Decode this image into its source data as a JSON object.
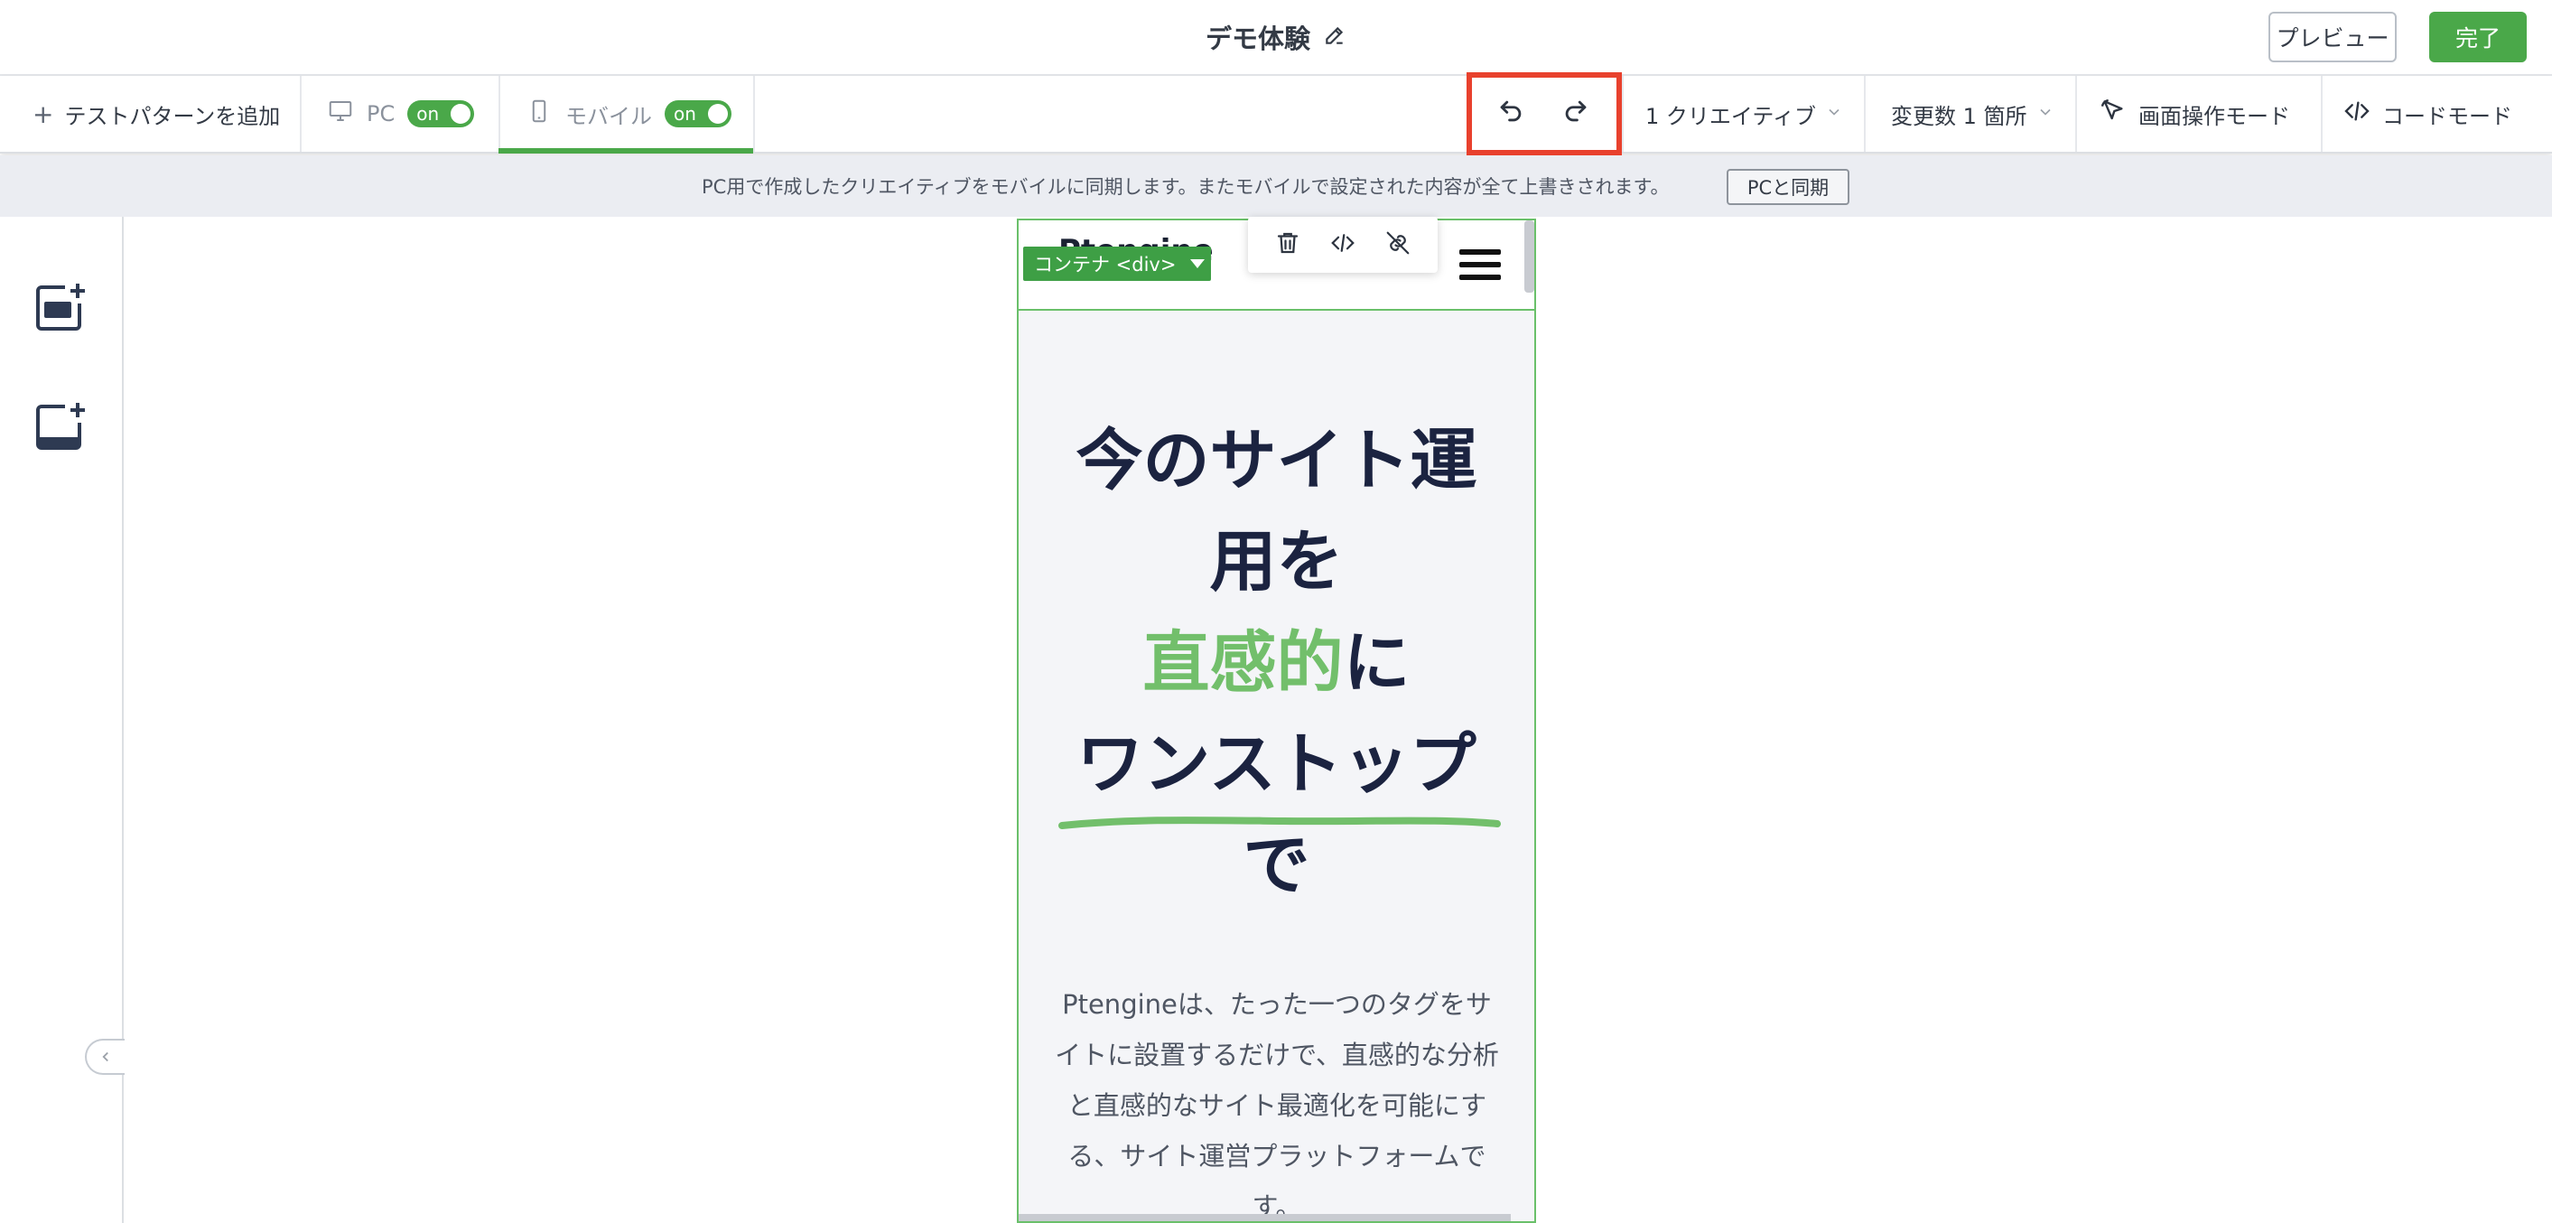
{
  "header": {
    "title": "デモ体験",
    "preview_label": "プレビュー",
    "done_label": "完了"
  },
  "toolbar": {
    "add_pattern_label": "テストパターンを追加",
    "pc_label": "PC",
    "pc_toggle": "on",
    "mobile_label": "モバイル",
    "mobile_toggle": "on",
    "creative_label": "1 クリエイティブ",
    "variables_label": "変更数 1 箇所",
    "cursor_mode_label": "画面操作モード",
    "code_mode_label": "コードモード"
  },
  "notice": {
    "text": "PC用で作成したクリエイティブをモバイルに同期します。またモバイルで設定された内容が全て上書きされます。",
    "sync_button": "PCと同期"
  },
  "editor": {
    "container_tag": "コンテナ <div>"
  },
  "canvas": {
    "logo_peek": "Ptengine",
    "hero": {
      "line1": "今のサイト運",
      "line2": "用を",
      "line3_green": "直感的",
      "line3_rest": "に",
      "line4": "ワンストップ",
      "line5": "で"
    },
    "description": "Ptengineは、たった一つのタグをサイトに設置するだけで、直感的な分析と直感的なサイト最適化を可能にする、サイト運営プラットフォームです。"
  },
  "colors": {
    "accent_green": "#4aa849",
    "highlight_green": "#72bf6b",
    "annotation_red": "#e8412d",
    "hero_navy": "#1b2340"
  }
}
